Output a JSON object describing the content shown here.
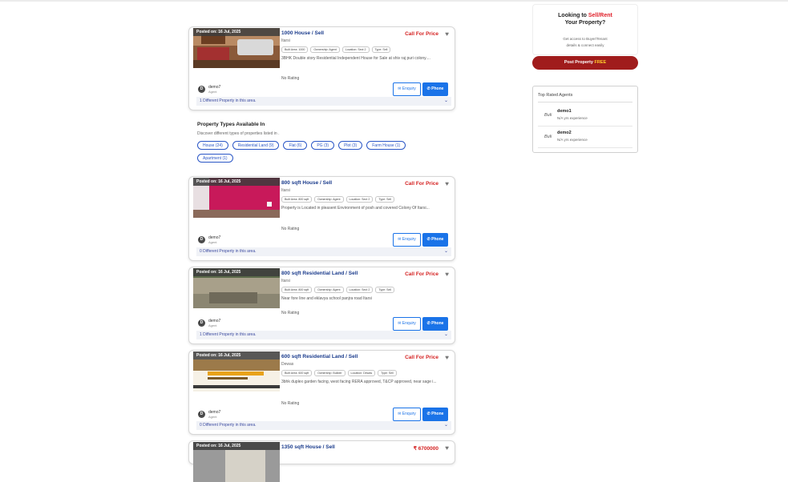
{
  "listings": [
    {
      "posted": "Posted on: 16 Jul, 2025",
      "title": "1000 House / Sell",
      "price": "Call For Price",
      "city": "Itarsi",
      "tags": [
        "Built Area: 1000",
        "Ownership: Agent",
        "Location: Sect 2",
        "Type: Sell"
      ],
      "description": "3BHK Double story Residential Independent House for Sale at shiv raj puri colony....",
      "rating": "No Rating",
      "agent_initial": "D",
      "agent_name": "demo7",
      "agent_role": "Agent",
      "enquiry_label": "✉ Enquiry",
      "phone_label": "✆ Phone",
      "area_note": "1 Different Property in this area."
    },
    {
      "posted": "Posted on: 16 Jul, 2025",
      "title": "800 sqft House / Sell",
      "price": "Call For Price",
      "city": "Itarsi",
      "tags": [
        "Built Area: 800 sqft",
        "Ownership: Agent",
        "Location: Sect 2",
        "Type: Sell"
      ],
      "description": "Property is Located in pleasent Environment of posh and covered Colony Of Itarsi...",
      "rating": "No Rating",
      "agent_initial": "D",
      "agent_name": "demo7",
      "agent_role": "Agent",
      "enquiry_label": "✉ Enquiry",
      "phone_label": "✆ Phone",
      "area_note": "0 Different Property in this area."
    },
    {
      "posted": "Posted on: 16 Jul, 2025",
      "title": "800 sqft Residential Land / Sell",
      "price": "Call For Price",
      "city": "Itarsi",
      "tags": [
        "Built Area: 800 sqft",
        "Ownership: Agent",
        "Location: Sect 2",
        "Type: Sell"
      ],
      "description": "Near fore line and eklavya school panjra road Itarsi",
      "rating": "No Rating",
      "agent_initial": "D",
      "agent_name": "demo7",
      "agent_role": "Agent",
      "enquiry_label": "✉ Enquiry",
      "phone_label": "✆ Phone",
      "area_note": "1 Different Property in this area."
    },
    {
      "posted": "Posted on: 16 Jul, 2025",
      "title": "600 sqft Residential Land / Sell",
      "price": "Call For Price",
      "city": "Dewas",
      "tags": [
        "Built Area: 600 sqft",
        "Ownership: Builder",
        "Location: Dewas",
        "Type: Sell"
      ],
      "description": "3bhk duplex garden facing, west facing RERA approved, T&CP approved, near sage i...",
      "rating": "No Rating",
      "agent_initial": "D",
      "agent_name": "demo7",
      "agent_role": "Agent",
      "enquiry_label": "✉ Enquiry",
      "phone_label": "✆ Phone",
      "area_note": "0 Different Property in this area."
    },
    {
      "posted": "Posted on: 16 Jul, 2025",
      "title": "1350 sqft House / Sell",
      "price": "₹ 6700000"
    }
  ],
  "property_types": {
    "heading": "Property Types Available In",
    "subheading": "Discover different types of properties listed in .",
    "pills": [
      "House (24)",
      "Residential Land (9)",
      "Flat (6)",
      "PG (3)",
      "Plot (3)",
      "Farm House (1)",
      "Apartment (1)"
    ]
  },
  "promo": {
    "line1_pre": "Looking to ",
    "line1_red": "Sell/Rent",
    "line2": "Your Property?",
    "sub1": "Get access to Buyer/Tenant",
    "sub2": "details & connect easily",
    "post_label": "Post Property ",
    "post_free": "FREE"
  },
  "top_agents": {
    "heading": "Top Rated Agents",
    "agents": [
      {
        "logo": "Buli",
        "name": "demo1",
        "exp": "N/A yrs experience"
      },
      {
        "logo": "Buli",
        "name": "demo2",
        "exp": "N/A yrs experience"
      }
    ]
  },
  "colors": {
    "price_red": "#d42020",
    "primary_blue": "#1a73e8",
    "post_button": "#a01c1c",
    "free_yellow": "#ffcb2b"
  }
}
